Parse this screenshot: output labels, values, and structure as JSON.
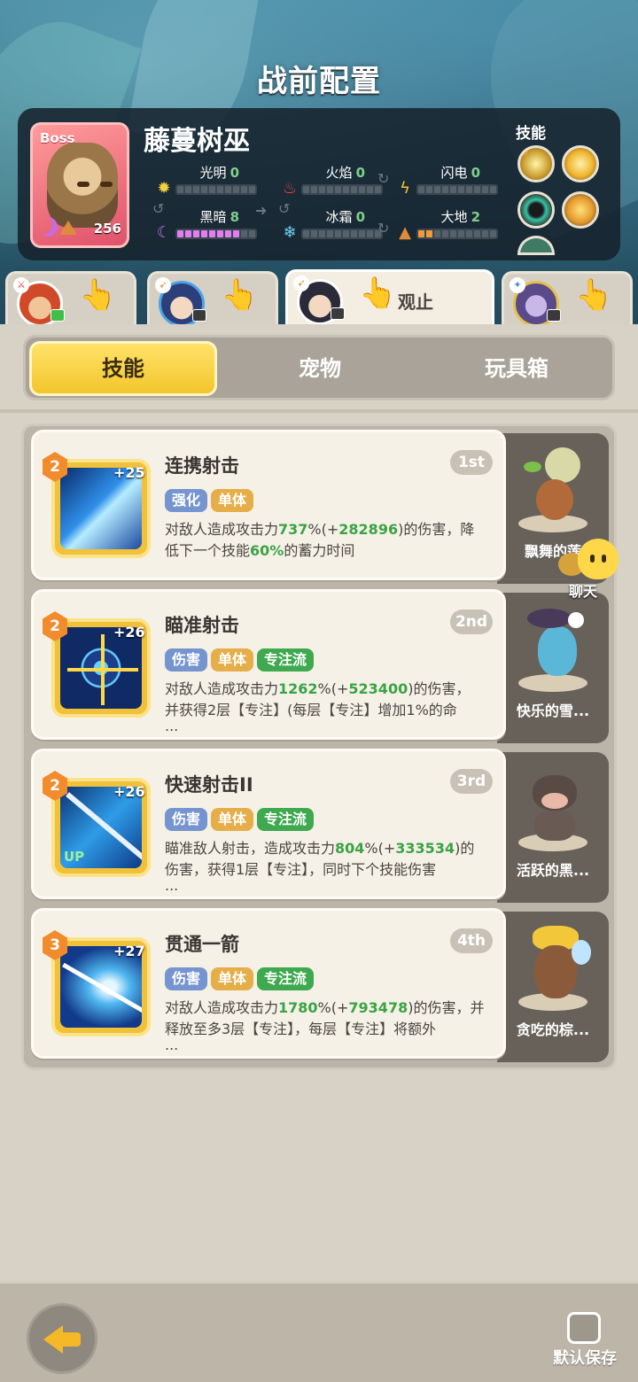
{
  "header": {
    "title": "战前配置"
  },
  "boss": {
    "tag": "Boss",
    "name": "藤蔓树巫",
    "level": "256",
    "elements": [
      {
        "name": "光明",
        "value": "0"
      },
      {
        "name": "火焰",
        "value": "0"
      },
      {
        "name": "闪电",
        "value": "0"
      },
      {
        "name": "黑暗",
        "value": "8"
      },
      {
        "name": "冰霜",
        "value": "0"
      },
      {
        "name": "大地",
        "value": "2"
      }
    ],
    "skills_label": "技能"
  },
  "players": [
    {
      "id": "player-1",
      "state": "ready"
    },
    {
      "id": "player-2",
      "state": "ready"
    },
    {
      "id": "player-3",
      "state": "watching",
      "label": "观止"
    },
    {
      "id": "player-4",
      "state": "ready"
    }
  ],
  "tabs": [
    {
      "label": "技能",
      "active": true
    },
    {
      "label": "宠物",
      "active": false
    },
    {
      "label": "玩具箱",
      "active": false
    }
  ],
  "skills": [
    {
      "level": "2",
      "plus": "+25",
      "name": "连携射击",
      "rank": "1st",
      "tags": [
        "强化",
        "单体"
      ],
      "desc_1": "对敌人造成攻击力",
      "hl_1": "737",
      "desc_2": "%(+",
      "hl_2": "282896",
      "desc_3": ")的伤害，降",
      "line2_a": "低下一个技能",
      "line2_hl": "60%",
      "line2_b": "的蓄力时间",
      "line3": "",
      "pet": "飘舞的莲"
    },
    {
      "level": "2",
      "plus": "+26",
      "name": "瞄准射击",
      "rank": "2nd",
      "tags": [
        "伤害",
        "单体",
        "专注流"
      ],
      "desc_1": "对敌人造成攻击力",
      "hl_1": "1262",
      "desc_2": "%(+",
      "hl_2": "523400",
      "desc_3": ")的伤害，",
      "line2_a": "并获得2层【专注】(每层【专注】增加1%的命",
      "line2_hl": "",
      "line2_b": "",
      "line3": "...",
      "pet": "快乐的雪..."
    },
    {
      "level": "2",
      "plus": "+26",
      "name": "快速射击II",
      "rank": "3rd",
      "tags": [
        "伤害",
        "单体",
        "专注流"
      ],
      "desc_1": "瞄准敌人射击，造成攻击力",
      "hl_1": "804",
      "desc_2": "%(+",
      "hl_2": "333534",
      "desc_3": ")的",
      "line2_a": "伤害，获得1层【专注】，同时下个技能伤害",
      "line2_hl": "",
      "line2_b": "",
      "line3": "...",
      "pet": "活跃的黑..."
    },
    {
      "level": "3",
      "plus": "+27",
      "name": "贯通一箭",
      "rank": "4th",
      "tags": [
        "伤害",
        "单体",
        "专注流"
      ],
      "desc_1": "对敌人造成攻击力",
      "hl_1": "1780",
      "desc_2": "%(+",
      "hl_2": "793478",
      "desc_3": ")的伤害，并",
      "line2_a": "释放至多3层【专注】，每层【专注】将额外",
      "line2_hl": "",
      "line2_b": "",
      "line3": "...",
      "pet": "贪吃的棕..."
    }
  ],
  "chat": {
    "label": "聊天"
  },
  "footer": {
    "save_label": "默认保存",
    "back_icon": "back-arrow-icon"
  },
  "colors": {
    "accent_yellow": "#f3c52b",
    "highlight_green": "#3aa345",
    "tag_blue": "#7694cf",
    "tag_orange": "#e6ae48",
    "tag_green": "#3ea94e"
  }
}
